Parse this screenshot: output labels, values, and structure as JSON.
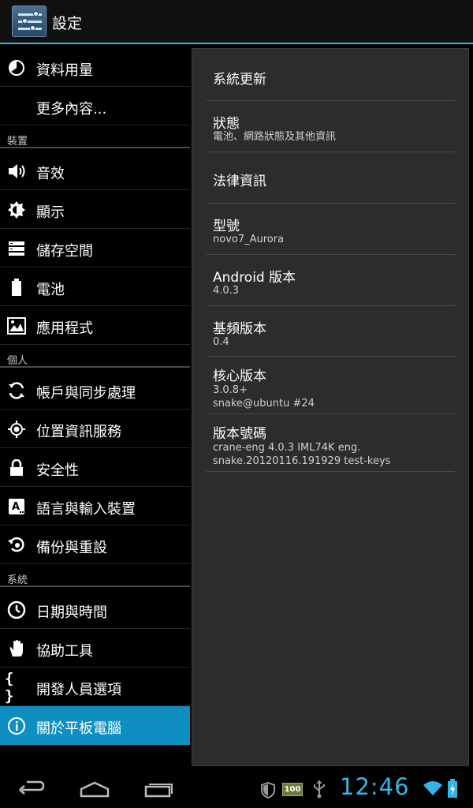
{
  "actionbar": {
    "title": "設定"
  },
  "sidebar": {
    "items": [
      {
        "label": "資料用量",
        "icon": "pie-chart-icon"
      },
      {
        "label": "更多內容..."
      },
      {
        "label": "音效",
        "icon": "speaker-icon"
      },
      {
        "label": "顯示",
        "icon": "brightness-icon"
      },
      {
        "label": "儲存空間",
        "icon": "storage-icon"
      },
      {
        "label": "電池",
        "icon": "battery-icon"
      },
      {
        "label": "應用程式",
        "icon": "apps-icon"
      },
      {
        "label": "帳戶與同步處理",
        "icon": "sync-icon"
      },
      {
        "label": "位置資訊服務",
        "icon": "location-icon"
      },
      {
        "label": "安全性",
        "icon": "lock-icon"
      },
      {
        "label": "語言與輸入裝置",
        "icon": "language-icon"
      },
      {
        "label": "備份與重設",
        "icon": "backup-icon"
      },
      {
        "label": "日期與時間",
        "icon": "clock-icon"
      },
      {
        "label": "協助工具",
        "icon": "hand-icon"
      },
      {
        "label": "開發人員選項",
        "icon": "braces-icon"
      },
      {
        "label": "關於平板電腦",
        "icon": "info-icon",
        "selected": true
      }
    ],
    "headers": [
      "裝置",
      "個人",
      "系統"
    ]
  },
  "about": {
    "system_update": "系統更新",
    "status_title": "狀態",
    "status_summary": "電池、網路狀態及其他資訊",
    "legal": "法律資訊",
    "model_title": "型號",
    "model_value": "novo7_Aurora",
    "android_title": "Android 版本",
    "android_value": "4.0.3",
    "baseband_title": "基頻版本",
    "baseband_value": "0.4",
    "kernel_title": "核心版本",
    "kernel_value_1": "3.0.8+",
    "kernel_value_2": "snake@ubuntu #24",
    "build_title": "版本號碼",
    "build_value_1": "crane-eng 4.0.3 IML74K eng.",
    "build_value_2": "snake.20120116.191929 test-keys"
  },
  "statusbar": {
    "time": "12:46",
    "battery_badge": "100"
  },
  "colors": {
    "accent": "#33b5e5",
    "selected": "#0f8ec2"
  }
}
